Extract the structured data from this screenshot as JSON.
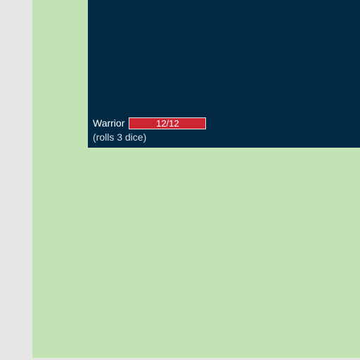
{
  "colors": {
    "page_background": "#e6e6e6",
    "board_background": "#c2e3b3",
    "panel_background": "#022a45",
    "hp_bar": "#cc2633"
  },
  "hero": {
    "name": "Warrior",
    "hp_text": "12/12",
    "hp_current": 12,
    "hp_max": 12,
    "note": "(rolls 3 dice)"
  }
}
